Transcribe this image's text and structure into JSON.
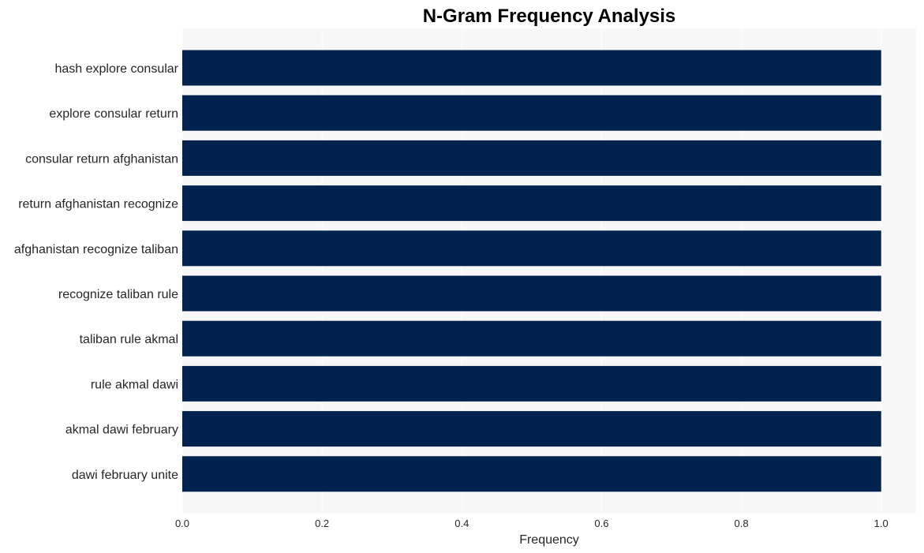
{
  "chart_data": {
    "type": "bar",
    "orientation": "horizontal",
    "title": "N-Gram Frequency Analysis",
    "xlabel": "Frequency",
    "ylabel": "",
    "categories": [
      "hash explore consular",
      "explore consular return",
      "consular return afghanistan",
      "return afghanistan recognize",
      "afghanistan recognize taliban",
      "recognize taliban rule",
      "taliban rule akmal",
      "rule akmal dawi",
      "akmal dawi february",
      "dawi february unite"
    ],
    "values": [
      1,
      1,
      1,
      1,
      1,
      1,
      1,
      1,
      1,
      1
    ],
    "xlim": [
      0,
      1.05
    ],
    "xticks": [
      "0.0",
      "0.2",
      "0.4",
      "0.6",
      "0.8",
      "1.0"
    ],
    "xtick_values": [
      0,
      0.2,
      0.4,
      0.6,
      0.8,
      1.0
    ],
    "grid": true,
    "legend": "none",
    "colors": {
      "bar": "#00224e",
      "plot_bg": "#f7f7f7",
      "grid": "#ffffff"
    }
  }
}
